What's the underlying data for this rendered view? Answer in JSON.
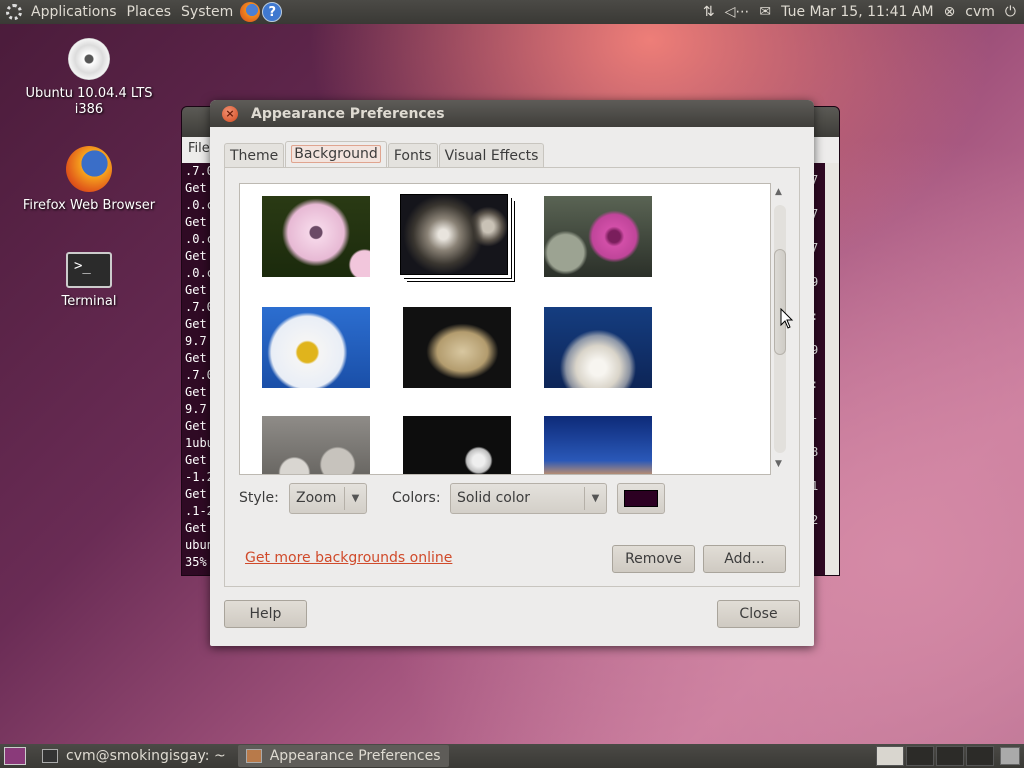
{
  "top_panel": {
    "menus": [
      "Applications",
      "Places",
      "System"
    ],
    "datetime": "Tue Mar 15, 11:41 AM",
    "user": "cvm",
    "icons": [
      "network-icon",
      "volume-icon",
      "mail-icon",
      "power-icon"
    ]
  },
  "desktop": {
    "icons": [
      {
        "label": "Ubuntu 10.04.4 LTS\ni386",
        "icon": "cd-icon"
      },
      {
        "label": "Firefox Web Browser",
        "icon": "firefox-icon"
      },
      {
        "label": "Terminal",
        "icon": "terminal-icon"
      }
    ]
  },
  "terminal": {
    "menu_label": "File",
    "lines": [
      ".7.0",
      "Get",
      ".0.c",
      "Get",
      ".0.c",
      "Get",
      ".0.c",
      "Get",
      ".7.0",
      "Get",
      "9.7",
      "Get",
      ".7.0",
      "Get",
      "9.7",
      "Get",
      "1ubu",
      "Get",
      "-1.2",
      "Get",
      ".1-2",
      "Get",
      "ubun",
      "35%"
    ],
    "right_col": [
      "7",
      "7",
      "7",
      "9",
      ":",
      "9",
      ":",
      "-",
      "8",
      "1",
      "2"
    ]
  },
  "dialog": {
    "title": "Appearance Preferences",
    "tabs": [
      "Theme",
      "Background",
      "Fonts",
      "Visual Effects"
    ],
    "active_tab": "Background",
    "style_label": "Style:",
    "style_value": "Zoom",
    "colors_label": "Colors:",
    "colors_value": "Solid color",
    "swatch_color": "#2c0022",
    "more_link": "Get more backgrounds online",
    "remove_label": "Remove",
    "add_label": "Add...",
    "help_label": "Help",
    "close_label": "Close"
  },
  "bottom_panel": {
    "tasks": [
      "cvm@smokingisgay: ~",
      "Appearance Preferences"
    ]
  }
}
